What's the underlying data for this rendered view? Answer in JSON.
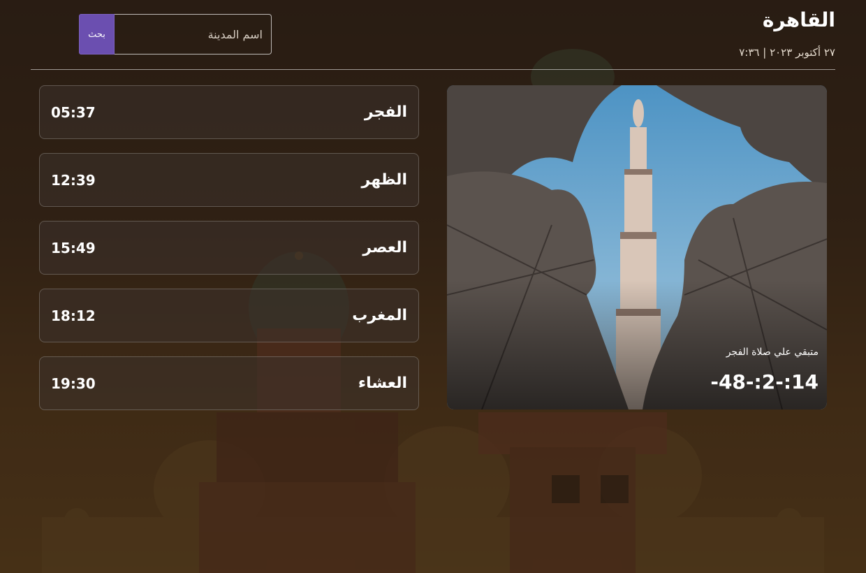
{
  "header": {
    "city": "القاهرة",
    "date": "٢٧ أكتوبر ٢٠٢٣ | ٧:٣٦"
  },
  "search": {
    "placeholder": "اسم المدينة",
    "button_label": "بحث",
    "button_color": "#6b4fb0"
  },
  "prayers": [
    {
      "name": "الفجر",
      "time": "05:37"
    },
    {
      "name": "الظهر",
      "time": "12:39"
    },
    {
      "name": "العصر",
      "time": "15:49"
    },
    {
      "name": "المغرب",
      "time": "18:12"
    },
    {
      "name": "العشاء",
      "time": "19:30"
    }
  ],
  "next_prayer": {
    "label": "متبقي علي صلاة الفجر",
    "countdown": "-48-:2-:14"
  }
}
